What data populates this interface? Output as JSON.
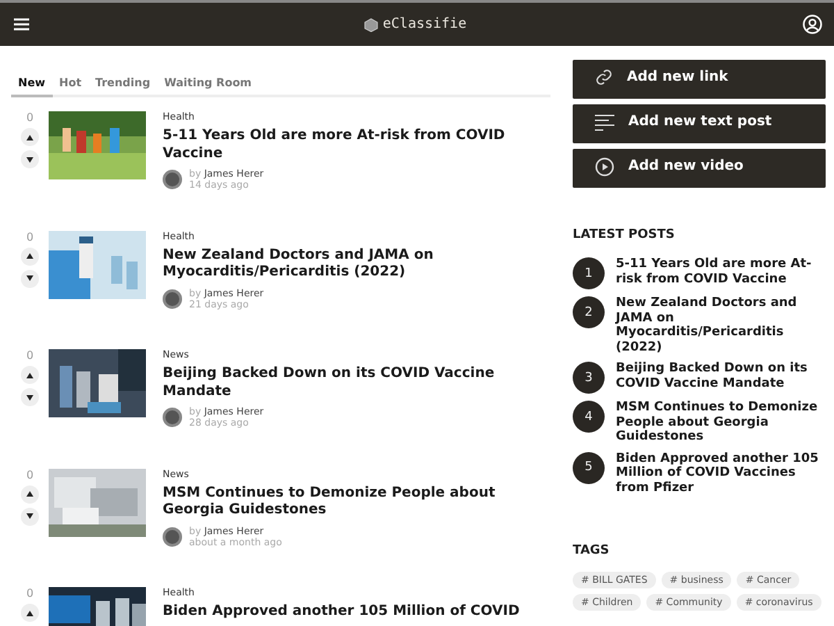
{
  "header": {
    "logo": "eClassifie"
  },
  "tabs": [
    {
      "label": "New",
      "selected": true
    },
    {
      "label": "Hot",
      "selected": false
    },
    {
      "label": "Trending",
      "selected": false
    },
    {
      "label": "Waiting Room",
      "selected": false
    }
  ],
  "posts": [
    {
      "votes": "0",
      "category": "Health",
      "title": "5-11 Years Old are more At-risk from COVID Vaccine",
      "by": "by",
      "author": "James Herer",
      "time": "14 days ago"
    },
    {
      "votes": "0",
      "category": "Health",
      "title": "New Zealand Doctors and JAMA on Myocarditis/Pericarditis (2022)",
      "by": "by",
      "author": "James Herer",
      "time": "21 days ago"
    },
    {
      "votes": "0",
      "category": "News",
      "title": "Beijing Backed Down on its COVID Vaccine Mandate",
      "by": "by",
      "author": "James Herer",
      "time": "28 days ago"
    },
    {
      "votes": "0",
      "category": "News",
      "title": "MSM Continues to Demonize People about Georgia Guidestones",
      "by": "by",
      "author": "James Herer",
      "time": "about a month ago"
    },
    {
      "votes": "0",
      "category": "Health",
      "title": "Biden Approved another 105 Million of COVID"
    }
  ],
  "actions": [
    {
      "label": "Add new link",
      "kind": "link"
    },
    {
      "label": "Add new text post",
      "kind": "text"
    },
    {
      "label": "Add new video",
      "kind": "video"
    }
  ],
  "latest_posts": {
    "title": "LATEST POSTS",
    "items": [
      {
        "number": "1",
        "title": "5-11 Years Old are more At-risk from COVID Vaccine"
      },
      {
        "number": "2",
        "title": "New Zealand Doctors and JAMA on Myocarditis/Pericarditis (2022)"
      },
      {
        "number": "3",
        "title": "Beijing Backed Down on its COVID Vaccine Mandate"
      },
      {
        "number": "4",
        "title": "MSM Continues to Demonize People about Georgia Guidestones"
      },
      {
        "number": "5",
        "title": "Biden Approved another 105 Million of COVID Vaccines from Pfizer"
      }
    ]
  },
  "tags": {
    "title": "TAGS",
    "items": [
      "# BILL GATES",
      "# business",
      "# Cancer",
      "# Children",
      "# Community",
      "# coronavirus"
    ]
  }
}
